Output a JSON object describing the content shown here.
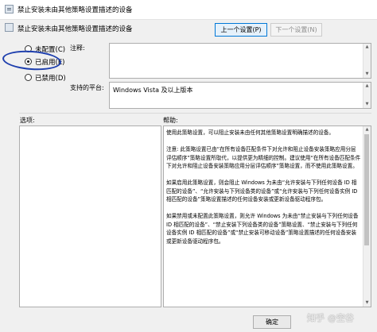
{
  "window": {
    "title": "禁止安装未由其他策略设置描述的设备"
  },
  "header": {
    "policy_name": "禁止安装未由其他策略设置描述的设备",
    "prev_button": "上一个设置(P)",
    "next_button": "下一个设置(N)"
  },
  "state_options": [
    {
      "label": "未配置(C)",
      "checked": false
    },
    {
      "label": "已启用(E)",
      "checked": true
    },
    {
      "label": "已禁用(D)",
      "checked": false
    }
  ],
  "comment": {
    "label": "注释:",
    "value": ""
  },
  "platform": {
    "label": "支持的平台:",
    "value": "Windows Vista 及以上版本"
  },
  "options_label": "选项:",
  "help": {
    "label": "帮助:",
    "paragraphs": [
      "使用此策略设置，可以阻止安装未由任何其他策略设置明确描述的设备。",
      "注意: 此策略设置已由“在所有设备匹配条件下对允许和阻止设备安装策略应用分层评估顺序”策略设置所取代，以提供更为精细的控制。建议使用“在所有设备匹配条件下对允许和阻止设备安装策略应用分层评估顺序”策略设置，而不使用此策略设置。",
      "如果启用此策略设置，则会阻止 Windows 为未由“允许安装与下列任何设备 ID 相匹配的设备”、“允许安装与下列设备类的设备”或“允许安装与下列任何设备实例 ID 相匹配的设备”策略设置描述的任何设备安装或更新设备驱动程序包。",
      "如果禁用或未配置此策略设置，则允许 Windows 为未由“禁止安装与下列任何设备 ID 相匹配的设备”、“禁止安装下列设备类的设备”策略设置、“禁止安装与下列任何设备实例 ID 相匹配的设备”或“禁止安装可移动设备”策略设置描述的任何设备安装或更新设备驱动程序包。"
    ]
  },
  "footer": {
    "ok_button": "确定",
    "watermark": "知乎 @空谷"
  },
  "colors": {
    "window_bg": "#f0f0f0",
    "highlight_oval": "#1e3fae",
    "primary_border": "#0078d7"
  }
}
